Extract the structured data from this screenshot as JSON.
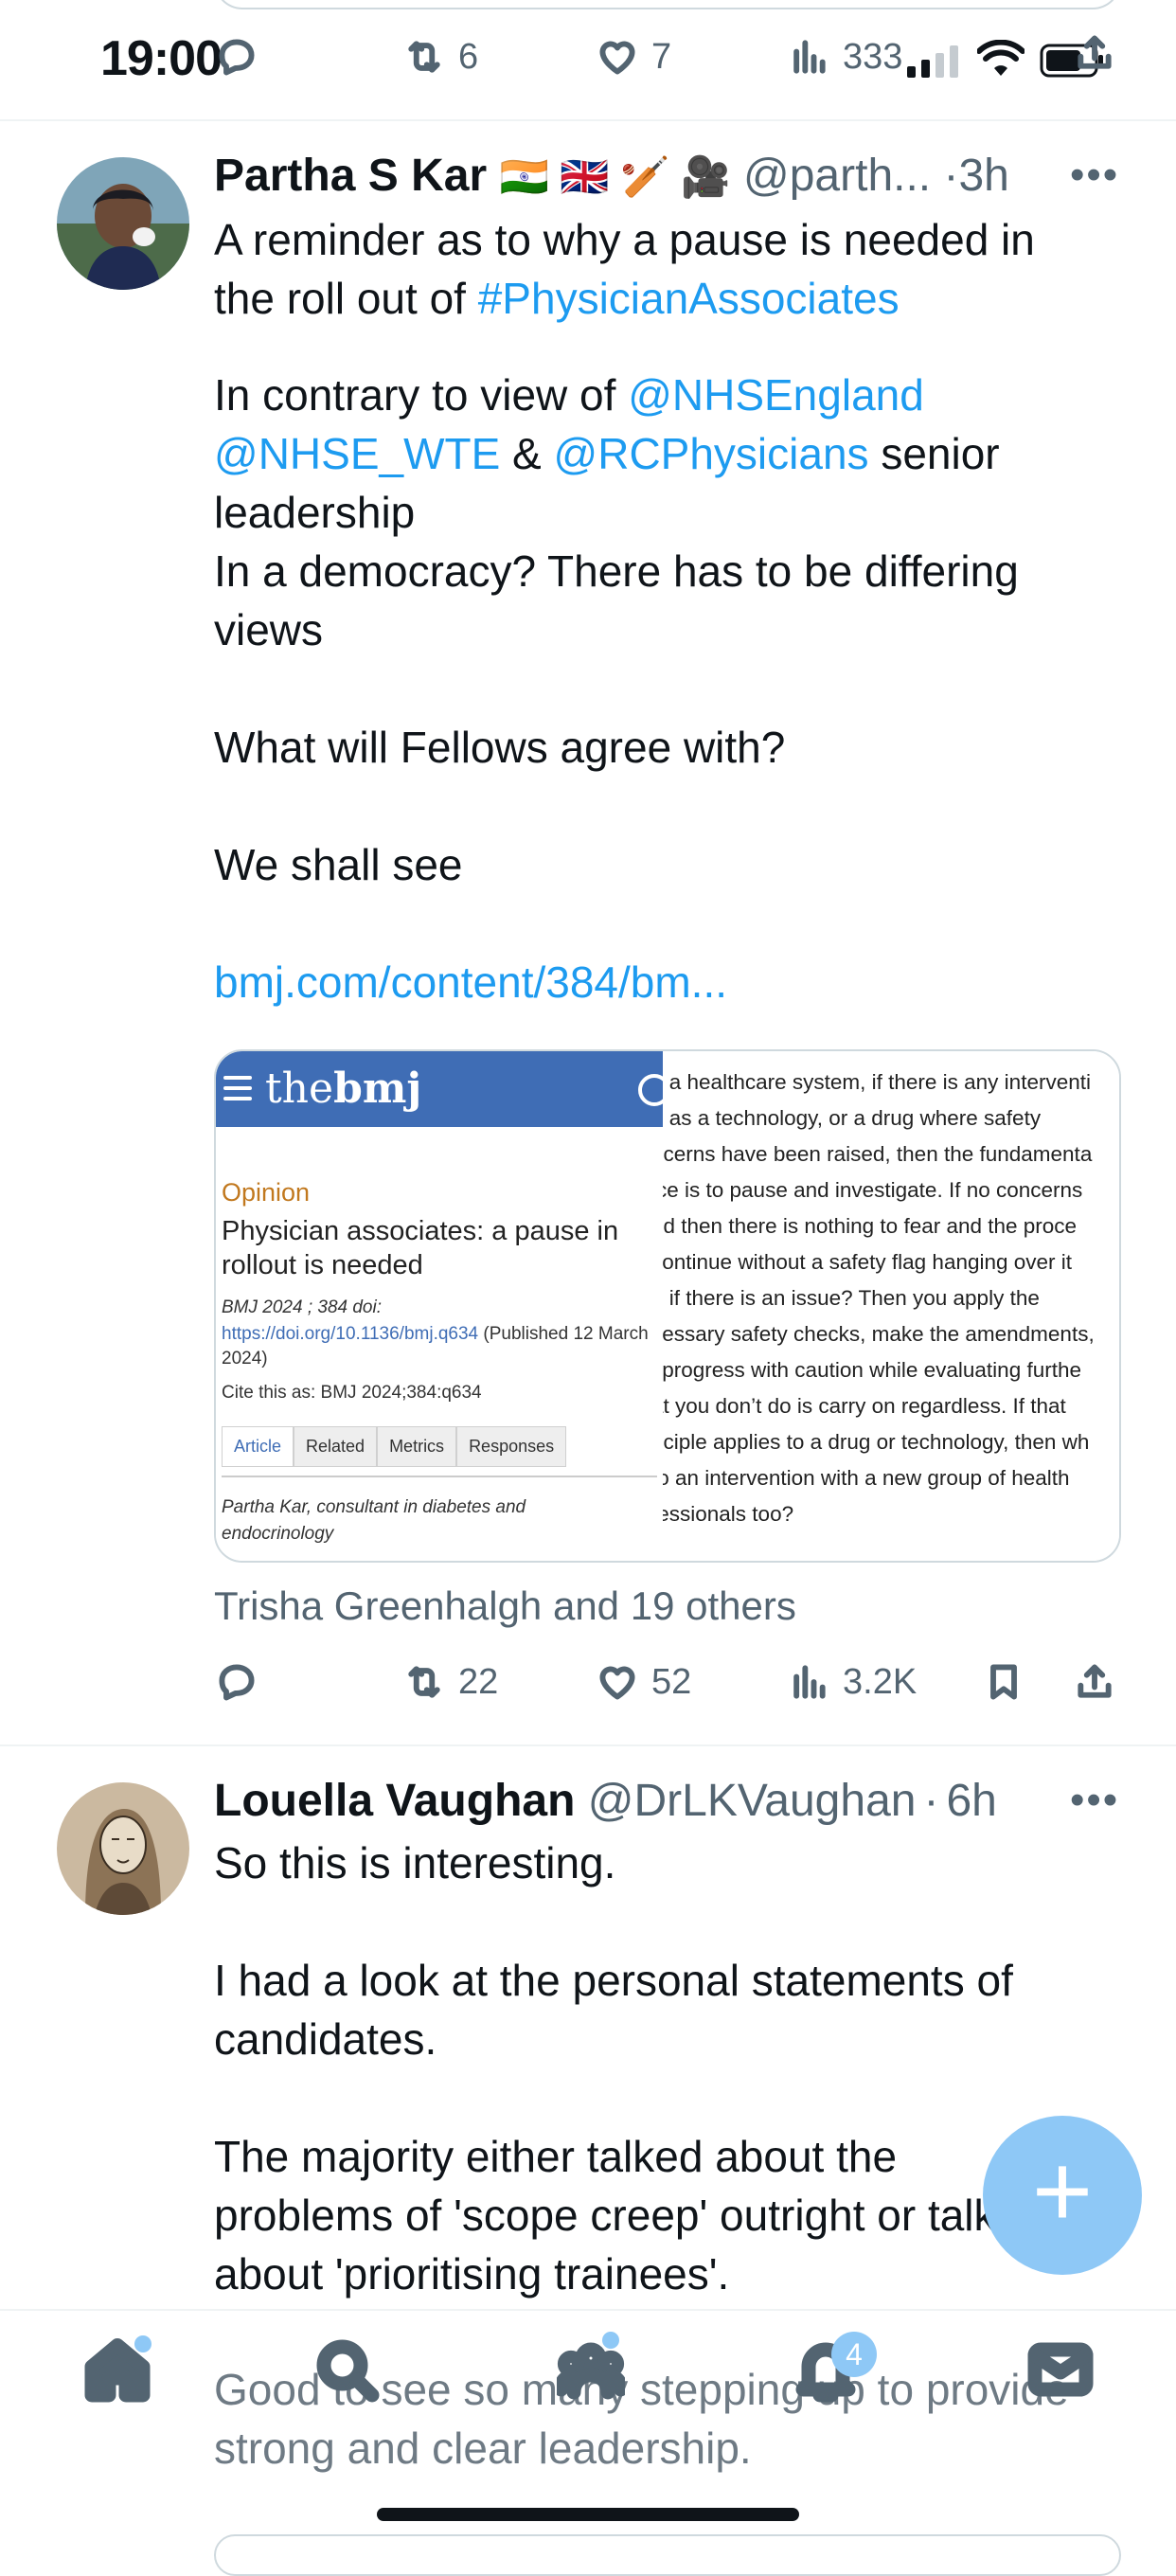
{
  "status_bar": {
    "time": "19:00"
  },
  "prev_tweet_actions": {
    "retweets": "6",
    "likes": "7",
    "views": "333"
  },
  "tweets": [
    {
      "author": "Partha S Kar",
      "flags": "🇮🇳 🇬🇧 🏏 🎥",
      "handle": "@parth...",
      "sep": "·",
      "time": "3h",
      "lines": {
        "l1": "A reminder as to why a pause is needed in",
        "l2a": "the roll out of ",
        "l2b": "#PhysicianAssociates",
        "l3a": "In contrary to view of ",
        "l3b": "@NHSEngland",
        "l4a": "@NHSE_WTE",
        "l4b": " & ",
        "l4c": "@RCPhysicians",
        "l4d": " senior",
        "l5": "leadership",
        "l6": "In a democracy? There has to be differing",
        "l7": "views",
        "l8": "What will Fellows agree with?",
        "l9": "We shall see",
        "l10": "bmj.com/content/384/bm..."
      },
      "card": {
        "logo_a": "the",
        "logo_b": "bmj",
        "opinion": "Opinion",
        "title": "Physician associates: a pause in rollout is needed",
        "meta1": "BMJ 2024 ; 384 doi:",
        "meta2_link": "https://doi.org/10.1136/bmj.q634",
        "meta2_rest": " (Published 12 March 2024)",
        "meta3": "Cite this as: BMJ 2024;384:q634",
        "tabs": [
          "Article",
          "Related",
          "Metrics",
          "Responses"
        ],
        "byline": "Partha Kar, consultant in diabetes and endocrinology",
        "excerpt": [
          "n a healthcare system, if there is any interventi",
          "h as a technology, or a drug where safety",
          "ncerns have been raised, then the fundamenta",
          "ice is to pause and investigate. If no concerns",
          "nd then there is nothing to fear and the proce",
          " continue without a safety flag hanging over it",
          "d if there is an issue? Then you apply the",
          "cessary safety checks, make the amendments,",
          "l progress with caution while evaluating furthe",
          "at you don’t do is carry on regardless. If that",
          "nciple applies to a drug or technology, then wh",
          " to an intervention with a new group of health",
          "fessionals too?"
        ]
      },
      "social_context": "Trisha Greenhalgh and 19 others",
      "stats": {
        "retweets": "22",
        "likes": "52",
        "views": "3.2K"
      }
    },
    {
      "author": "Louella Vaughan",
      "handle": "@DrLKVaughan",
      "sep": "·",
      "time": "6h",
      "lines": {
        "l1": "So this is interesting.",
        "l2": "I had a look at the personal statements of",
        "l3": "candidates.",
        "l4": "The majority either talked about the",
        "l5": "problems of 'scope creep' outright or talked",
        "l6": "about 'prioritising trainees'.",
        "l7": "Good to see so many stepping up to provide",
        "l8": "strong and clear leadership."
      }
    }
  ],
  "bottom_nav": {
    "items": [
      "home-icon",
      "search-icon",
      "communities-icon",
      "notifications-icon",
      "messages-icon"
    ],
    "notification_count": "4"
  },
  "fab": {
    "symbol": "+"
  },
  "colors": {
    "link": "#1d9bf0",
    "muted": "#536471",
    "fab": "#8ec8f6",
    "bmj_blue": "#3f6db5"
  }
}
